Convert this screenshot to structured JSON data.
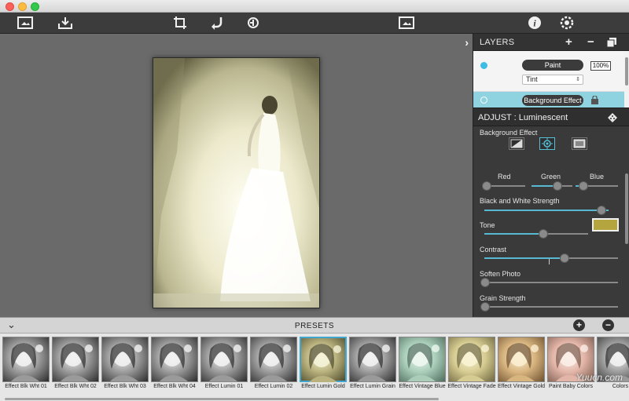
{
  "canvas": {
    "expand_glyph": "›"
  },
  "layers": {
    "title": "LAYERS",
    "add_glyph": "+",
    "remove_glyph": "−",
    "layer1": {
      "name": "Paint",
      "opacity": "100%",
      "blend": "Tint",
      "dot_color": "#3dbde3"
    },
    "layer2": {
      "name": "Background Effect",
      "dot_color": "#ffffff"
    }
  },
  "adjust": {
    "title": "ADJUST : Luminescent",
    "background_effect_label": "Background Effect",
    "selected_effect_button": "luminescent",
    "sliders": {
      "red": {
        "label": "Red",
        "value": 0
      },
      "green": {
        "label": "Green",
        "value": 0.62
      },
      "blue": {
        "label": "Blue",
        "value": 0.1
      },
      "bw_strength": {
        "label": "Black and White Strength",
        "value": 0.98
      },
      "tone": {
        "label": "Tone",
        "value": 0.58,
        "color": "#b4a53f"
      },
      "contrast": {
        "label": "Contrast",
        "value": 0.62
      },
      "soften": {
        "label": "Soften Photo",
        "value": 0
      },
      "grain": {
        "label": "Grain Strength",
        "value": 0
      }
    }
  },
  "presets": {
    "title": "PRESETS",
    "collapse_glyph": "⌄",
    "add_glyph": "+",
    "remove_glyph": "−",
    "selected_index": 6,
    "items": [
      {
        "label": "Effect Blk Wht 01",
        "tint": "gray"
      },
      {
        "label": "Effect Blk Wht 02",
        "tint": "gray"
      },
      {
        "label": "Effect Blk Wht 03",
        "tint": "gray"
      },
      {
        "label": "Effect Blk Wht 04",
        "tint": "gray"
      },
      {
        "label": "Effect Lumin 01",
        "tint": "gray"
      },
      {
        "label": "Effect Lumin 02",
        "tint": "gray"
      },
      {
        "label": "Effect Lumin Gold",
        "tint": "gold"
      },
      {
        "label": "Effect Lumin Grain",
        "tint": "gray"
      },
      {
        "label": "Effect Vintage Blue",
        "tint": "mint"
      },
      {
        "label": "Effect Vintage Fade",
        "tint": "cream"
      },
      {
        "label": "Effect Vintage Gold",
        "tint": "warm"
      },
      {
        "label": "Paint Baby Colors",
        "tint": "pink"
      },
      {
        "label": "Colors",
        "tint": "gray"
      }
    ]
  },
  "watermark": "Yuucn.com"
}
